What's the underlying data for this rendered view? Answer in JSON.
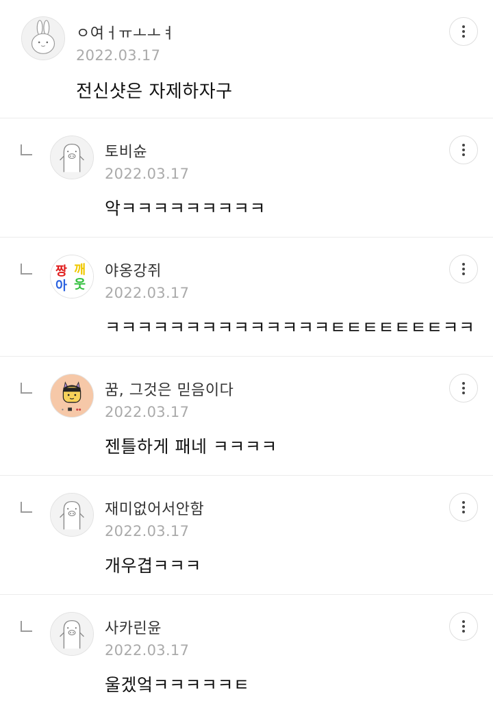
{
  "comments": [
    {
      "nickname": "ㅇ여ㅓㅠㅗㅗㅕ",
      "date": "2022.03.17",
      "text": "전신샷은 자제하자구",
      "avatar": "rabbit-avatar-icon"
    },
    {
      "nickname": "토비슌",
      "date": "2022.03.17",
      "text": "악ㅋㅋㅋㅋㅋㅋㅋㅋㅋ",
      "avatar": "default-pig-avatar-icon"
    },
    {
      "nickname": "야옹강쥐",
      "date": "2022.03.17",
      "text": "ㅋㅋㅋㅋㅋㅋㅋㅋㅋㅋㅋㅋㅋㅋㅌㅌㅌㅌㅌㅌㅌㅋㅋ",
      "avatar": "sticker-avatar-icon",
      "avatar_text": [
        "짱",
        "깨",
        "아",
        "웃"
      ]
    },
    {
      "nickname": "꿈, 그것은 믿음이다",
      "date": "2022.03.17",
      "text": "젠틀하게 패네 ㅋㅋㅋㅋ",
      "avatar": "cartoon-kid-avatar-icon"
    },
    {
      "nickname": "재미없어서안함",
      "date": "2022.03.17",
      "text": "개우겹ㅋㅋㅋ",
      "avatar": "default-pig-avatar-icon"
    },
    {
      "nickname": "사카린윤",
      "date": "2022.03.17",
      "text": "울겠엌ㅋㅋㅋㅋㅋㅌ",
      "avatar": "default-pig-avatar-icon"
    }
  ],
  "colors": {
    "divider": "#ececec",
    "date": "#aaaaaa",
    "text": "#111111"
  }
}
